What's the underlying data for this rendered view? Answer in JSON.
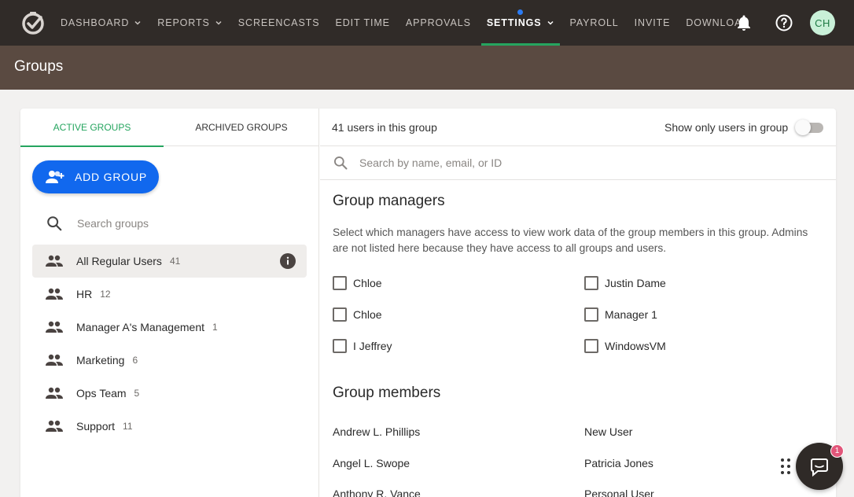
{
  "nav": {
    "items": [
      {
        "label": "DASHBOARD",
        "dropdown": true,
        "active": false
      },
      {
        "label": "REPORTS",
        "dropdown": true,
        "active": false
      },
      {
        "label": "SCREENCASTS",
        "dropdown": false,
        "active": false
      },
      {
        "label": "EDIT TIME",
        "dropdown": false,
        "active": false
      },
      {
        "label": "APPROVALS",
        "dropdown": false,
        "active": false
      },
      {
        "label": "SETTINGS",
        "dropdown": true,
        "active": true
      },
      {
        "label": "PAYROLL",
        "dropdown": false,
        "active": false
      },
      {
        "label": "INVITE",
        "dropdown": false,
        "active": false
      },
      {
        "label": "DOWNLOAD",
        "dropdown": false,
        "active": false
      }
    ],
    "avatar_initials": "CH"
  },
  "page": {
    "title": "Groups"
  },
  "tabs": {
    "active": "ACTIVE GROUPS",
    "archived": "ARCHIVED GROUPS"
  },
  "add_group_label": "ADD GROUP",
  "group_search": {
    "placeholder": "Search groups"
  },
  "groups": [
    {
      "name": "All Regular Users",
      "count": "41",
      "selected": true
    },
    {
      "name": "HR",
      "count": "12",
      "selected": false
    },
    {
      "name": "Manager A's Management",
      "count": "1",
      "selected": false
    },
    {
      "name": "Marketing",
      "count": "6",
      "selected": false
    },
    {
      "name": "Ops Team",
      "count": "5",
      "selected": false
    },
    {
      "name": "Support",
      "count": "11",
      "selected": false
    }
  ],
  "right": {
    "user_count_text": "41 users in this group",
    "show_only_label": "Show only users in group",
    "show_only_enabled": false,
    "user_search_placeholder": "Search by name, email, or ID",
    "managers_heading": "Group managers",
    "managers_description": "Select which managers have access to view work data of the group members in this group. Admins are not listed here because they have access to all groups and users.",
    "managers": [
      {
        "name": "Chloe",
        "checked": false
      },
      {
        "name": "Justin Dame",
        "checked": false
      },
      {
        "name": "Chloe",
        "checked": false
      },
      {
        "name": "Manager 1",
        "checked": false
      },
      {
        "name": "I Jeffrey",
        "checked": false
      },
      {
        "name": "WindowsVM",
        "checked": false
      }
    ],
    "members_heading": "Group members",
    "members": [
      "Andrew L. Phillips",
      "New User",
      "Angel L. Swope",
      "Patricia Jones",
      "Anthony R. Vance",
      "Personal User"
    ]
  },
  "chat": {
    "badge": "1"
  },
  "colors": {
    "accent_green": "#25a55f",
    "primary_blue": "#1168ee",
    "nav_bg": "#302b28",
    "header_bg": "#5a4a41"
  }
}
